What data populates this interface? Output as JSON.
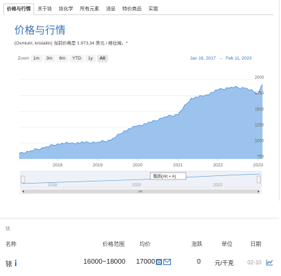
{
  "tabs": [
    "价格与行情",
    "关于铱",
    "铱化学",
    "所有元素",
    "消息",
    "特价商品",
    "买锇"
  ],
  "heading": "价格与行情",
  "subline": "(Osmium, kristallin) 当前价格是 1.973,34 美元 / 格拉姆。*",
  "zoom": {
    "label": "Zoom",
    "buttons": [
      "1m",
      "3m",
      "6m",
      "YTD",
      "1y",
      "All"
    ],
    "active": "All"
  },
  "range": {
    "from": "Jan 16, 2017",
    "arrow": "→",
    "to": "Feb 11, 2023"
  },
  "navigator_tooltip": "截图(Alt + A)",
  "nav_labels": [
    "2018",
    "2020",
    "2022"
  ],
  "chart_data": {
    "type": "area",
    "x": [
      "2017-01-16",
      "2017-05",
      "2017-09",
      "2018-01",
      "2018-05",
      "2018-09",
      "2019-01",
      "2019-05",
      "2019-09",
      "2020-01",
      "2020-05",
      "2020-09",
      "2021-01",
      "2021-05",
      "2021-09",
      "2022-01",
      "2022-05",
      "2022-09",
      "2023-01",
      "2023-02-11"
    ],
    "y": [
      830,
      880,
      925,
      990,
      1000,
      1005,
      1015,
      1045,
      1195,
      1275,
      1325,
      1415,
      1450,
      1710,
      1750,
      1840,
      1885,
      1870,
      1790,
      1930
    ],
    "ylim": [
      750,
      2050
    ],
    "yticks": [
      "750",
      "1000",
      "1250",
      "1500",
      "1750",
      "2000"
    ],
    "xticks": [
      "2018",
      "2019",
      "2020",
      "2021",
      "2022",
      "2023"
    ],
    "color": "#90bdec",
    "line_color": "#4a90d9"
  },
  "table": {
    "title": "铱",
    "headers": {
      "name": "名称",
      "range": "价格范围",
      "avg": "均价",
      "change": "涨跌",
      "unit": "单位",
      "date": "日期"
    },
    "row": {
      "name": "铱",
      "range": "16000~18000",
      "avg": "17000",
      "change": "0",
      "unit": "元/千克",
      "date": "02-10"
    }
  },
  "colors": {
    "accent": "#3c74b8",
    "area": "#90bdec"
  },
  "icons": [
    "info-icon",
    "calendar-icon",
    "mail-icon",
    "trend-chart-icon"
  ]
}
